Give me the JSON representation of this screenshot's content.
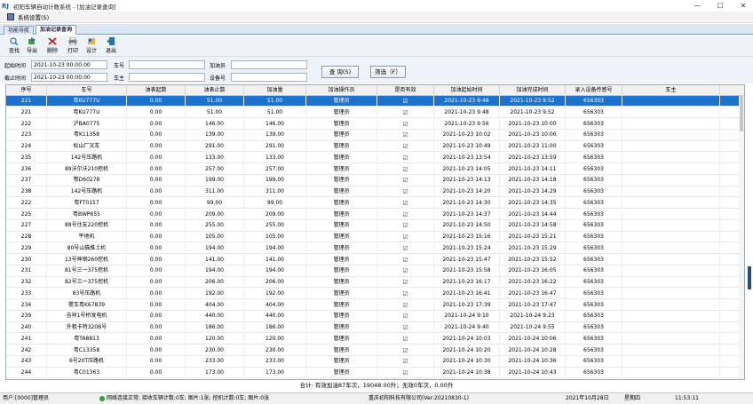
{
  "window": {
    "title": "初阳车辆自动计数系统 - [加油记录查询]",
    "logo": "RJ",
    "minimize": "—",
    "maximize": "☐",
    "close": "✕"
  },
  "menu": {
    "label": "系统设置(S)"
  },
  "tabs": [
    {
      "label": "功能导航",
      "active": false
    },
    {
      "label": "加油记录查询",
      "active": true
    }
  ],
  "toolbar": {
    "buttons": [
      {
        "label": "查找",
        "icon": "search-icon"
      },
      {
        "label": "导出",
        "icon": "export-icon"
      },
      {
        "label": "删除",
        "icon": "delete-icon"
      },
      {
        "label": "打印",
        "icon": "print-icon"
      },
      {
        "label": "设计",
        "icon": "design-icon"
      },
      {
        "label": "退出",
        "icon": "exit-icon"
      }
    ]
  },
  "filters": {
    "start_label": "起始时间",
    "start_value": "2021-10-23 00:00:00",
    "end_label": "截止时间",
    "end_value": "2021-10-23 00:00:00",
    "plate_label": "车号",
    "owner_label": "车主",
    "fueler_label": "加油员",
    "device_label": "设备号",
    "query_button": "查 询(S)",
    "filter_button": "筛选（F）"
  },
  "grid": {
    "columns": [
      "序号",
      "车号",
      "油表起数",
      "油表止数",
      "加油量",
      "加油操作员",
      "是否有效",
      "加油起始时间",
      "加油完成时间",
      "录入设备传感号",
      "车主"
    ],
    "rows": [
      [
        "221",
        "粤KU777U",
        "0.00",
        "51.00",
        "51.00",
        "管理员",
        "☑",
        "2021-10-23 9:48",
        "2021-10-23 9:52",
        "656303",
        ""
      ],
      [
        "221",
        "粤KU777U",
        "0.00",
        "51.00",
        "51.00",
        "管理员",
        "☑",
        "2021-10-23 9:48",
        "2021-10-23 9:52",
        "656303",
        ""
      ],
      [
        "222",
        "沪BA0775",
        "0.00",
        "146.00",
        "146.00",
        "管理员",
        "☑",
        "2021-10-23 9:56",
        "2021-10-23 10:00",
        "656303",
        ""
      ],
      [
        "223",
        "粤K11358",
        "0.00",
        "139.00",
        "139.00",
        "管理员",
        "☑",
        "2021-10-23 10:02",
        "2021-10-23 10:06",
        "656303",
        ""
      ],
      [
        "224",
        "松山厂叉车",
        "0.00",
        "291.00",
        "291.00",
        "管理员",
        "☑",
        "2021-10-23 10:49",
        "2021-10-23 11:00",
        "656303",
        ""
      ],
      [
        "235",
        "142号压路机",
        "0.00",
        "133.00",
        "133.00",
        "管理员",
        "☑",
        "2021-10-23 13:54",
        "2021-10-23 13:59",
        "656303",
        ""
      ],
      [
        "236",
        "89沃尔沃210挖机",
        "0.00",
        "257.00",
        "257.00",
        "管理员",
        "☑",
        "2021-10-23 14:05",
        "2021-10-23 14:11",
        "656303",
        ""
      ],
      [
        "237",
        "鄂D60278",
        "0.00",
        "199.00",
        "199.00",
        "管理员",
        "☑",
        "2021-10-23 14:13",
        "2021-10-23 14:18",
        "656303",
        ""
      ],
      [
        "238",
        "142号压路机",
        "0.00",
        "311.00",
        "311.00",
        "管理员",
        "☑",
        "2021-10-23 14:20",
        "2021-10-23 14:29",
        "656303",
        ""
      ],
      [
        "222",
        "粤FT0157",
        "0.00",
        "99.00",
        "99.00",
        "管理员",
        "☑",
        "2021-10-23 14:30",
        "2021-10-23 14:35",
        "656303",
        ""
      ],
      [
        "225",
        "粤BWP655",
        "0.00",
        "209.00",
        "209.00",
        "管理员",
        "☑",
        "2021-10-23 14:37",
        "2021-10-23 14:44",
        "656303",
        ""
      ],
      [
        "227",
        "88号住友220挖机",
        "0.00",
        "255.00",
        "255.00",
        "管理员",
        "☑",
        "2021-10-23 14:50",
        "2021-10-23 14:58",
        "656303",
        ""
      ],
      [
        "228",
        "平地机",
        "0.00",
        "105.00",
        "105.00",
        "管理员",
        "☑",
        "2021-10-23 15:16",
        "2021-10-23 15:21",
        "656303",
        ""
      ],
      [
        "229",
        "80号山猫推土机",
        "0.00",
        "194.00",
        "194.00",
        "管理员",
        "☑",
        "2021-10-23 15:24",
        "2021-10-23 15:29",
        "656303",
        ""
      ],
      [
        "230",
        "13号神钢260挖机",
        "0.00",
        "141.00",
        "141.00",
        "管理员",
        "☑",
        "2021-10-23 15:47",
        "2021-10-23 15:52",
        "656303",
        ""
      ],
      [
        "231",
        "81号三一375挖机",
        "0.00",
        "194.00",
        "194.00",
        "管理员",
        "☑",
        "2021-10-23 15:58",
        "2021-10-23 16:05",
        "656303",
        ""
      ],
      [
        "232",
        "82号三一375挖机",
        "0.00",
        "206.00",
        "206.00",
        "管理员",
        "☑",
        "2021-10-23 16:17",
        "2021-10-23 16:22",
        "656303",
        ""
      ],
      [
        "233",
        "83号压路机",
        "0.00",
        "192.00",
        "192.00",
        "管理员",
        "☑",
        "2021-10-23 16:41",
        "2021-10-23 16:47",
        "656303",
        ""
      ],
      [
        "234",
        "搅车粤K67839",
        "0.00",
        "404.00",
        "404.00",
        "管理员",
        "☑",
        "2021-10-23 17:39",
        "2021-10-23 17:47",
        "656303",
        ""
      ],
      [
        "239",
        "吉祥1号桥发电机",
        "0.00",
        "440.00",
        "440.00",
        "管理员",
        "☑",
        "2021-10-24 9:10",
        "2021-10-24 9:23",
        "656303",
        ""
      ],
      [
        "240",
        "外租卡特320B号",
        "0.00",
        "186.00",
        "186.00",
        "管理员",
        "☑",
        "2021-10-24 9:40",
        "2021-10-24 9:55",
        "656303",
        ""
      ],
      [
        "241",
        "粤TA8813",
        "0.00",
        "120.00",
        "120.00",
        "管理员",
        "☑",
        "2021-10-24 10:03",
        "2021-10-24 10:06",
        "656303",
        ""
      ],
      [
        "242",
        "粤C13358",
        "0.00",
        "230.00",
        "230.00",
        "管理员",
        "☑",
        "2021-10-24 10:20",
        "2021-10-24 10:28",
        "656303",
        ""
      ],
      [
        "243",
        "6号20T压路机",
        "0.00",
        "233.00",
        "233.00",
        "管理员",
        "☑",
        "2021-10-24 10:30",
        "2021-10-24 10:36",
        "656303",
        ""
      ],
      [
        "244",
        "粤C01363",
        "0.00",
        "173.00",
        "173.00",
        "管理员",
        "☑",
        "2021-10-24 10:38",
        "2021-10-24 10:43",
        "656303",
        ""
      ]
    ]
  },
  "total": "合计: 有效加油87车次，19048.00升；无效0车次，0.00升",
  "status": {
    "user": "用户:[0000]管理员",
    "network": "网络连接正常; 接收车辆计数:0车; 图片:1张; 挖机计数:0车; 图片:0张",
    "company": "重庆初阳科技有限公司(Ver:20210830-1)",
    "date": "2021年10月28日",
    "weekday": "星期四",
    "time": "11:53:11"
  },
  "colors": {
    "selection": "#1b72d1",
    "accent": "#1060c0",
    "status_ok": "#1faa3a"
  }
}
